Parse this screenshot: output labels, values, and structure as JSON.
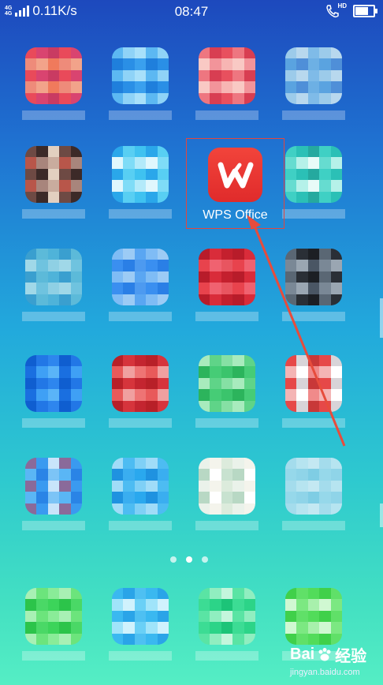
{
  "status_bar": {
    "signal_label": [
      "4G",
      "4G"
    ],
    "net_speed": "0.11K/s",
    "time": "08:47",
    "hd_label": "HD",
    "battery_level_percent": 80
  },
  "highlighted_app": {
    "label": "WPS Office",
    "icon_color": "#e92f2f"
  },
  "pager": {
    "pages": 3,
    "active_index": 1
  },
  "watermark": {
    "brand_latin": "Bai",
    "brand_cn": "经验",
    "url": "jingyan.baidu.com"
  },
  "colors": {
    "highlight_frame": "#e3463f",
    "arrow": "#e74c3c"
  }
}
